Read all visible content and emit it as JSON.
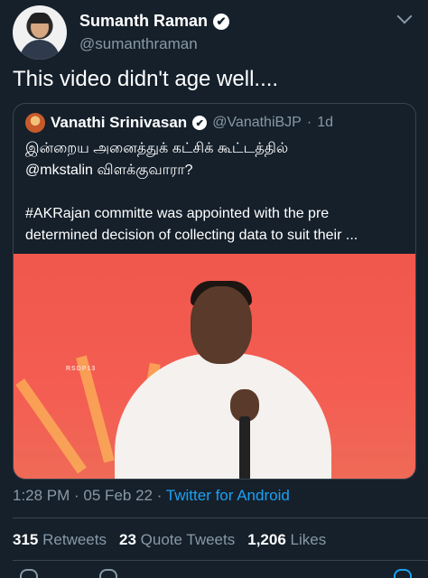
{
  "author": {
    "display_name": "Sumanth Raman",
    "handle": "@sumanthraman",
    "verified_glyph": "✔"
  },
  "tweet": {
    "text": "This video didn't age well...."
  },
  "quoted": {
    "display_name": "Vanathi Srinivasan",
    "verified_glyph": "✔",
    "handle": "@VanathiBJP",
    "dot": "·",
    "time": "1d",
    "line1": "இன்றைய அனைத்துக் கட்சிக் கூட்டத்தில்",
    "line2": "@mkstalin விளக்குவாரா?",
    "line3": "#AKRajan committe was appointed with the pre",
    "line4": "determined decision of collecting data to suit their ...",
    "media_stage_text": "RSDP13"
  },
  "meta": {
    "time": "1:28 PM",
    "sep1": " · ",
    "date": "05 Feb 22",
    "sep2": " · ",
    "source": "Twitter for Android"
  },
  "stats": {
    "retweets_count": "315",
    "retweets_label": "Retweets",
    "quotes_count": "23",
    "quotes_label": "Quote Tweets",
    "likes_count": "1,206",
    "likes_label": "Likes"
  },
  "icons": {
    "more": "chevron-down-icon",
    "verified": "verified-badge-icon"
  },
  "colors": {
    "background": "#15202b",
    "secondary_text": "#8899a6",
    "link": "#1da1f2",
    "border": "#38444d"
  }
}
